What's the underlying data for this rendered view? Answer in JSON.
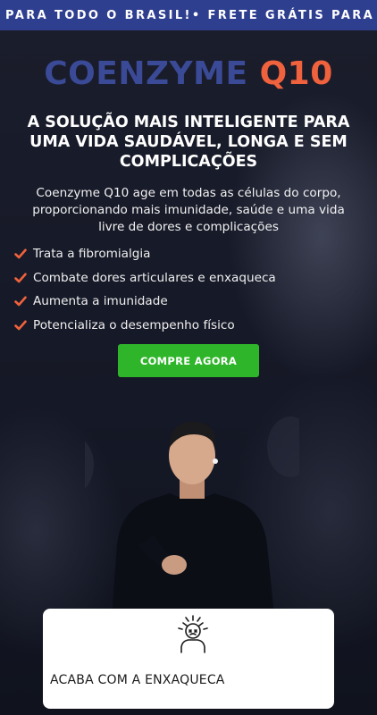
{
  "topbar": {
    "marquee": "PARA TODO O BRASIL!•  FRETE GRÁTIS PARA TODO O BRASIL!"
  },
  "brand": {
    "part1": "COENZYME ",
    "part2": "Q10"
  },
  "headline": "A SOLUÇÃO MAIS INTELIGENTE PARA UMA VIDA SAUDÁVEL, LONGA E SEM COMPLICAÇÕES",
  "subtext": "Coenzyme Q10 age em todas as células do corpo, proporcionando mais imunidade, saúde e uma vida livre de dores e complicações",
  "benefits": [
    "Trata a fibromialgia",
    "Combate dores articulares e enxaqueca",
    "Aumenta a imunidade",
    "Potencializa o desempenho físico"
  ],
  "cta": {
    "label": "COMPRE AGORA"
  },
  "feature_card": {
    "label": "ACABA COM A ENXAQUECA",
    "icon": "headache-person-icon"
  },
  "colors": {
    "topbar": "#2f3f8f",
    "brand_blue": "#3a4a96",
    "brand_orange": "#f0623d",
    "cta_green": "#2fb52a",
    "check_orange": "#f0623d"
  }
}
